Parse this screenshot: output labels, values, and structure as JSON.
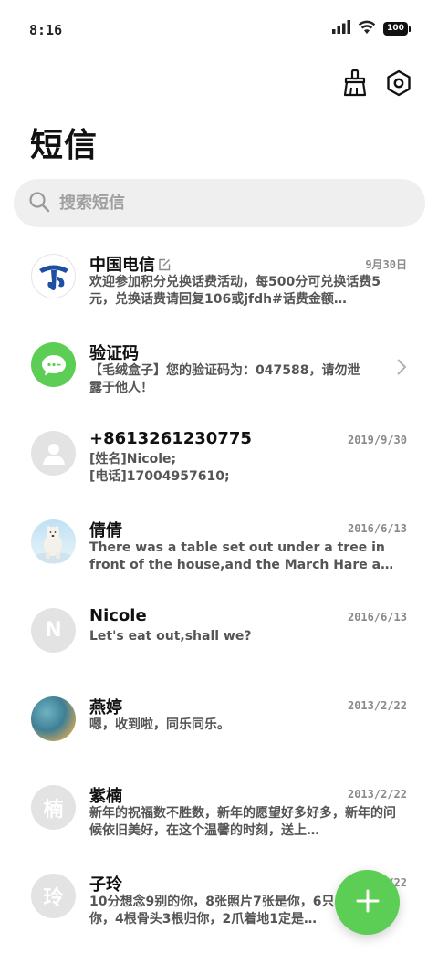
{
  "status_bar": {
    "time": "8:16",
    "battery_level": "100"
  },
  "header": {
    "title": "短信"
  },
  "search": {
    "placeholder": "搜索短信"
  },
  "colors": {
    "accent_green": "#5ccd55",
    "telecom_blue": "#1e4fa3"
  },
  "conversations": [
    {
      "name": "中国电信",
      "date": "9月30日",
      "preview": "欢迎参加积分兑换话费活动，每500分可兑换话费5元，兑换话费请回复106或jfdh#话费金额…",
      "avatar": "china-telecom-logo"
    },
    {
      "name": "验证码",
      "date": "",
      "preview": "【毛绒盒子】您的验证码为：047588，请勿泄露于他人！",
      "avatar": "message-bubble-icon"
    },
    {
      "name": "+8613261230775",
      "date": "2019/9/30",
      "preview_lines": [
        "[姓名]Nicole;",
        "[电话]17004957610;"
      ],
      "avatar": "person-icon"
    },
    {
      "name": "倩倩",
      "date": "2016/6/13",
      "preview": "There was a table set out under a tree in front of the house,and the March Hare a…",
      "avatar": "polar-bear-photo"
    },
    {
      "name": "Nicole",
      "date": "2016/6/13",
      "preview": "Let's eat out,shall we?",
      "avatar_letter": "N"
    },
    {
      "name": "燕婷",
      "date": "2013/2/22",
      "preview": "嗯，收到啦，同乐同乐。",
      "avatar": "ocean-photo"
    },
    {
      "name": "紫楠",
      "date": "2013/2/22",
      "preview": "新年的祝福数不胜数，新年的愿望好多好多，新年的问候依旧美好，在这个温馨的时刻，送上…",
      "avatar_letter": "楠"
    },
    {
      "name": "子玲",
      "date": "2013/2/22",
      "preview": "10分想念9别的你，8张照片7张是你，6只羊5只像你，4根骨头3根归你，2爪着地1定是…",
      "avatar_letter": "玲"
    }
  ]
}
